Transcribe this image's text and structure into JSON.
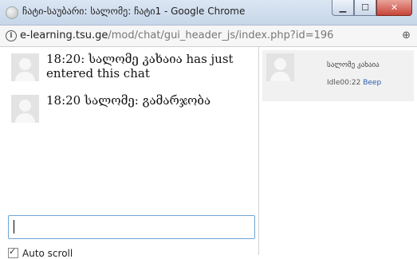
{
  "window": {
    "title": "ჩატი-საუბარი: სალომე: ჩატი1 - Google Chrome",
    "min_label": "▁",
    "max_label": "☐",
    "close_label": "✕"
  },
  "address": {
    "info_glyph": "i",
    "host": "e-learning.tsu.ge",
    "path": "/mod/chat/gui_header_js/index.php?id=196",
    "zoom_glyph": "⊕"
  },
  "messages": [
    {
      "text": "18:20: სალომე კახაია has just entered this chat"
    },
    {
      "text": "18:20 სალომე: გამარჯობა"
    }
  ],
  "input": {
    "value": ""
  },
  "autoscroll": {
    "label": "Auto scroll",
    "checked": true
  },
  "users": [
    {
      "name": "სალომე კახაია",
      "idle": "Idle00:22",
      "beep_label": "Beep"
    }
  ]
}
